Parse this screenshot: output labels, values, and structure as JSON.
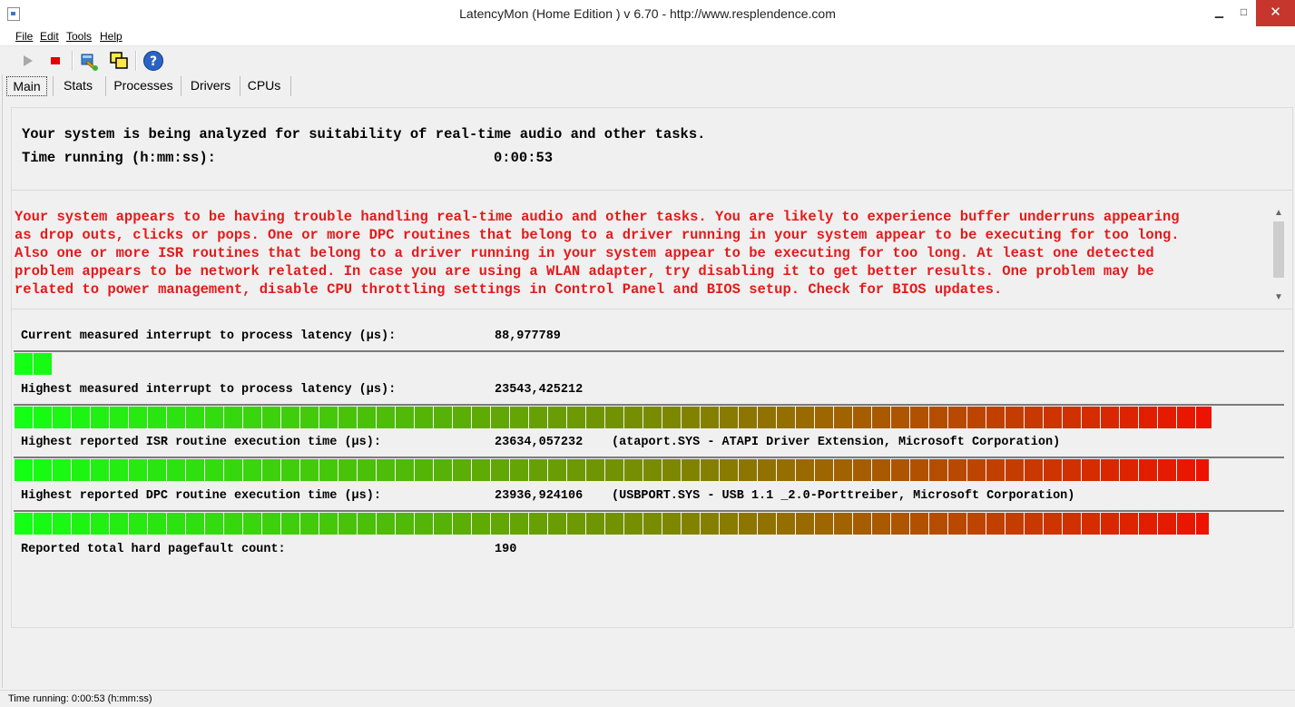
{
  "window": {
    "title": "LatencyMon  (Home Edition )  v 6.70 - http://www.resplendence.com",
    "min_glyph": "▁",
    "max_glyph": "□",
    "close_glyph": "✕"
  },
  "menu": [
    {
      "label": "File"
    },
    {
      "label": "Edit"
    },
    {
      "label": "Tools"
    },
    {
      "label": "Help"
    }
  ],
  "toolbar": {
    "icons": [
      "play-icon",
      "stop-icon",
      "wrench-icon",
      "windows-icon",
      "help-icon"
    ],
    "help_glyph": "?"
  },
  "tabs": [
    {
      "label": "Main",
      "active": true
    },
    {
      "label": "Stats",
      "active": false
    },
    {
      "label": "Processes",
      "active": false
    },
    {
      "label": "Drivers",
      "active": false
    },
    {
      "label": "CPUs",
      "active": false
    }
  ],
  "main": {
    "headline": "Your system is being analyzed for suitability of real-time audio and other tasks.",
    "time_label": "Time running (h:mm:ss):",
    "time_value": "0:00:53",
    "warning": "Your system appears to be having trouble handling real-time audio and other tasks. You are likely to experience buffer underruns appearing\nas drop outs, clicks or pops. One or more DPC routines that belong to a driver running in your system appear to be executing for too long.\nAlso one or more ISR routines that belong to a driver running in your system appear to be executing for too long. At least one detected\nproblem appears to be network related. In case you are using a WLAN adapter, try disabling it to get better results. One problem may be\nrelated to power management, disable CPU throttling settings in Control Panel and BIOS setup. Check for BIOS updates.",
    "metrics": [
      {
        "label": "Current measured interrupt to process latency (µs):",
        "value": "88,977789",
        "extra": "",
        "level": 0.03
      },
      {
        "label": "Highest measured interrupt to process latency (µs):",
        "value": "23543,425212",
        "extra": "",
        "level": 0.945
      },
      {
        "label": "Highest reported ISR routine execution time (µs):",
        "value": "23634,057232",
        "extra": "(ataport.SYS - ATAPI Driver Extension, Microsoft Corporation)",
        "level": 0.943
      },
      {
        "label": "Highest reported DPC routine execution time (µs):",
        "value": "23936,924106",
        "extra": "(USBPORT.SYS - USB 1.1 _2.0-Porttreiber, Microsoft Corporation)",
        "level": 0.943
      }
    ],
    "pagefault_label": "Reported total hard pagefault count:",
    "pagefault_value": "190"
  },
  "statusbar": {
    "text": "Time running: 0:00:53  (h:mm:ss)"
  },
  "colors": {
    "warning": "#e41a1a",
    "bar_start": "#14ff14",
    "bar_mid": "#7a8a00",
    "bar_end": "#ff0000"
  }
}
